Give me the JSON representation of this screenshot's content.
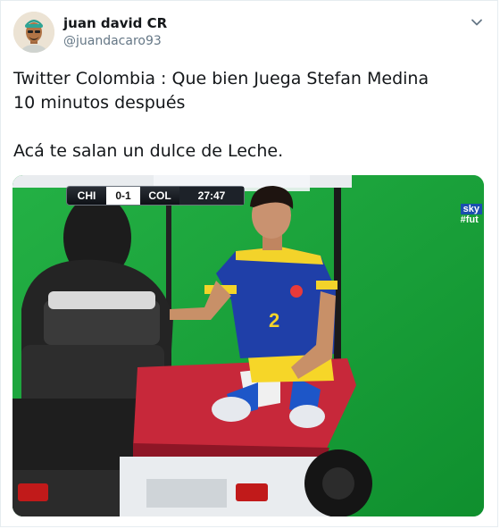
{
  "tweet": {
    "author_name": "juan david CR",
    "author_handle": "@juandacaro93",
    "text": "Twitter Colombia : Que bien Juega Stefan Medina\n10 minutos después\n\nAcá te salan un dulce de Leche."
  },
  "media": {
    "scorebug": {
      "team_home": "CHI",
      "score": "0-1",
      "team_away": "COL",
      "clock": "27:47"
    },
    "broadcaster": "sky",
    "hashtag_fragment": "#fut",
    "player_number": "2"
  },
  "icons": {
    "menu": "chevron-down-icon",
    "avatar": "user-avatar"
  },
  "colors": {
    "text": "#14171a",
    "secondary_text": "#657786",
    "pitch": "#17a23a",
    "jersey": "#1f3fa8"
  }
}
